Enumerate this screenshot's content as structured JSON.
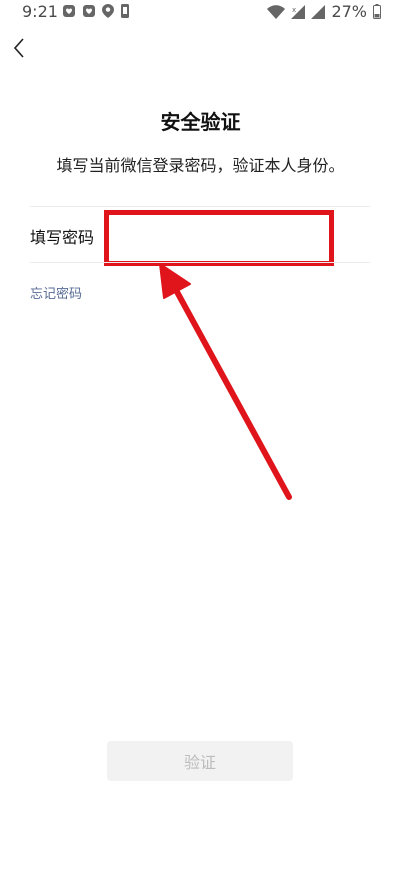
{
  "status_bar": {
    "time": "9:21",
    "battery": "27%",
    "icons_left": [
      "app-notification-icon",
      "app-notification-icon",
      "location-icon",
      "phone-icon"
    ],
    "icons_right": [
      "wifi-icon",
      "signal-icon",
      "signal-icon",
      "battery-icon"
    ]
  },
  "header": {
    "back_icon": "chevron-left-icon"
  },
  "main": {
    "title": "安全验证",
    "subtitle": "填写当前微信登录密码，验证本人身份。",
    "password_label": "填写密码",
    "password_value": "",
    "forgot_link": "忘记密码",
    "submit_label": "验证"
  },
  "colors": {
    "highlight": "#e0141b",
    "link": "#576b95",
    "button_bg": "#f2f2f2",
    "button_text": "#bcbcbc"
  }
}
